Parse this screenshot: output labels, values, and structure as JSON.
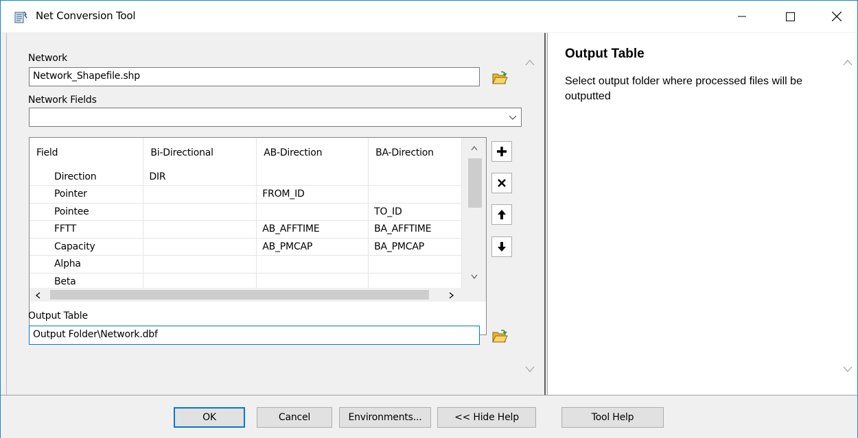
{
  "window": {
    "title": "Net Conversion Tool",
    "icon": "script-tool-icon"
  },
  "form": {
    "network_label": "Network",
    "network_value": "Network_Shapefile.shp",
    "network_fields_label": "Network Fields",
    "network_fields_value": "",
    "grid": {
      "headers": [
        "Field",
        "Bi-Directional",
        "AB-Direction",
        "BA-Direction"
      ],
      "rows": [
        [
          "Direction",
          "DIR",
          "",
          ""
        ],
        [
          "Pointer",
          "",
          "FROM_ID",
          ""
        ],
        [
          "Pointee",
          "",
          "",
          "TO_ID"
        ],
        [
          "FFTT",
          "",
          "AB_AFFTIME",
          "BA_AFFTIME"
        ],
        [
          "Capacity",
          "",
          "AB_PMCAP",
          "BA_PMCAP"
        ],
        [
          "Alpha",
          "",
          "",
          ""
        ],
        [
          "Beta",
          "",
          "",
          ""
        ]
      ]
    },
    "output_table_label": "Output Table",
    "output_table_value": "Output Folder\\Network.dbf"
  },
  "help": {
    "title": "Output Table",
    "text": "Select output folder where processed files will be outputted"
  },
  "buttons": {
    "ok": "OK",
    "cancel": "Cancel",
    "environments": "Environments...",
    "hide_help": "<< Hide Help",
    "tool_help": "Tool Help"
  },
  "colors": {
    "accent": "#0078d7",
    "folder": "#f3c84e"
  }
}
